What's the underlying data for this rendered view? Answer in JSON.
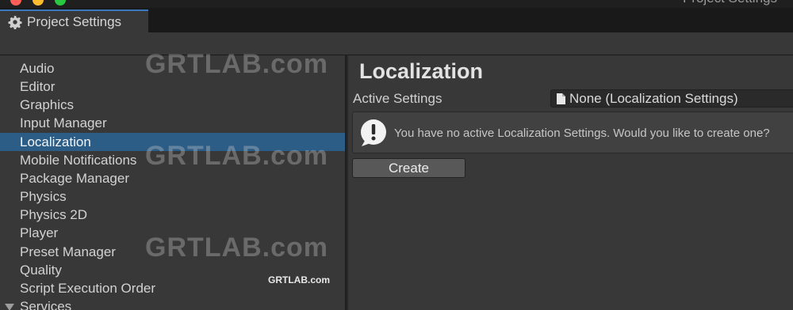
{
  "window": {
    "title": "Project Settings",
    "traffic_colors": [
      "#ff5f57",
      "#febc2e",
      "#28c840"
    ]
  },
  "tab": {
    "icon": "gear-icon",
    "label": "Project Settings",
    "accent": "#3a79bb"
  },
  "sidebar": {
    "selected_color": "#2c5d87",
    "items": [
      {
        "label": "Audio"
      },
      {
        "label": "Editor"
      },
      {
        "label": "Graphics"
      },
      {
        "label": "Input Manager"
      },
      {
        "label": "Localization",
        "selected": true
      },
      {
        "label": "Mobile Notifications"
      },
      {
        "label": "Package Manager"
      },
      {
        "label": "Physics"
      },
      {
        "label": "Physics 2D"
      },
      {
        "label": "Player"
      },
      {
        "label": "Preset Manager"
      },
      {
        "label": "Quality"
      },
      {
        "label": "Script Execution Order"
      },
      {
        "label": "Services",
        "foldout": "expanded"
      }
    ]
  },
  "main": {
    "title": "Localization",
    "active_settings": {
      "label": "Active Settings",
      "icon": "document-icon",
      "value": "None (Localization Settings)"
    },
    "help_box": {
      "icon": "warning-icon",
      "message": "You have no active Localization Settings. Would you like to create one?"
    },
    "create_label": "Create"
  },
  "watermarks": {
    "large": "GRTLAB.com",
    "small": "GRTLAB.com"
  }
}
